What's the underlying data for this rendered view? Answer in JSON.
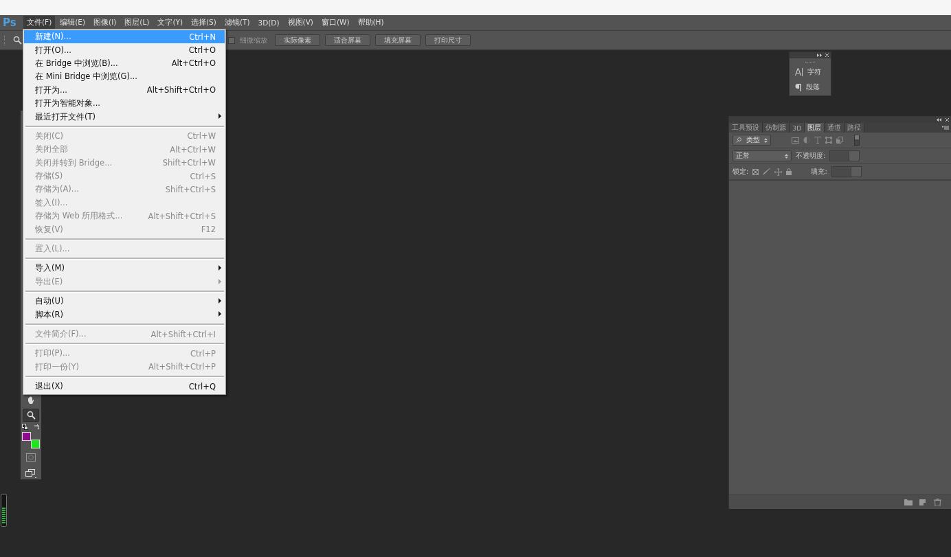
{
  "app": {
    "logo": "Ps"
  },
  "menubar": [
    {
      "label": "文件(F)",
      "selected": true
    },
    {
      "label": "编辑(E)",
      "selected": false
    },
    {
      "label": "图像(I)",
      "selected": false
    },
    {
      "label": "图层(L)",
      "selected": false
    },
    {
      "label": "文字(Y)",
      "selected": false
    },
    {
      "label": "选择(S)",
      "selected": false
    },
    {
      "label": "滤镜(T)",
      "selected": false
    },
    {
      "label": "3D(D)",
      "selected": false
    },
    {
      "label": "视图(V)",
      "selected": false
    },
    {
      "label": "窗口(W)",
      "selected": false
    },
    {
      "label": "帮助(H)",
      "selected": false
    }
  ],
  "options_bar": {
    "checkbox": {
      "label": "细微缩放",
      "checked": false
    },
    "buttons": [
      "实际像素",
      "适合屏幕",
      "填充屏幕",
      "打印尺寸"
    ]
  },
  "file_menu": [
    {
      "kind": "item",
      "label": "新建(N)...",
      "shortcut": "Ctrl+N",
      "disabled": false,
      "selected": true,
      "submenu": false
    },
    {
      "kind": "item",
      "label": "打开(O)...",
      "shortcut": "Ctrl+O",
      "disabled": false,
      "selected": false,
      "submenu": false
    },
    {
      "kind": "item",
      "label": "在 Bridge 中浏览(B)...",
      "shortcut": "Alt+Ctrl+O",
      "disabled": false,
      "selected": false,
      "submenu": false
    },
    {
      "kind": "item",
      "label": "在 Mini Bridge 中浏览(G)...",
      "disabled": false,
      "selected": false,
      "submenu": false
    },
    {
      "kind": "item",
      "label": "打开为...",
      "shortcut": "Alt+Shift+Ctrl+O",
      "disabled": false,
      "selected": false,
      "submenu": false
    },
    {
      "kind": "item",
      "label": "打开为智能对象...",
      "disabled": false,
      "selected": false,
      "submenu": false
    },
    {
      "kind": "item",
      "label": "最近打开文件(T)",
      "disabled": false,
      "selected": false,
      "submenu": true
    },
    {
      "kind": "separator"
    },
    {
      "kind": "item",
      "label": "关闭(C)",
      "shortcut": "Ctrl+W",
      "disabled": true,
      "selected": false,
      "submenu": false
    },
    {
      "kind": "item",
      "label": "关闭全部",
      "shortcut": "Alt+Ctrl+W",
      "disabled": true,
      "selected": false,
      "submenu": false
    },
    {
      "kind": "item",
      "label": "关闭并转到 Bridge...",
      "shortcut": "Shift+Ctrl+W",
      "disabled": true,
      "selected": false,
      "submenu": false
    },
    {
      "kind": "item",
      "label": "存储(S)",
      "shortcut": "Ctrl+S",
      "disabled": true,
      "selected": false,
      "submenu": false
    },
    {
      "kind": "item",
      "label": "存储为(A)...",
      "shortcut": "Shift+Ctrl+S",
      "disabled": true,
      "selected": false,
      "submenu": false
    },
    {
      "kind": "item",
      "label": "签入(I)...",
      "disabled": true,
      "selected": false,
      "submenu": false
    },
    {
      "kind": "item",
      "label": "存储为 Web 所用格式...",
      "shortcut": "Alt+Shift+Ctrl+S",
      "disabled": true,
      "selected": false,
      "submenu": false
    },
    {
      "kind": "item",
      "label": "恢复(V)",
      "shortcut": "F12",
      "disabled": true,
      "selected": false,
      "submenu": false
    },
    {
      "kind": "separator"
    },
    {
      "kind": "item",
      "label": "置入(L)...",
      "disabled": true,
      "selected": false,
      "submenu": false
    },
    {
      "kind": "separator"
    },
    {
      "kind": "item",
      "label": "导入(M)",
      "disabled": false,
      "selected": false,
      "submenu": true
    },
    {
      "kind": "item",
      "label": "导出(E)",
      "disabled": true,
      "selected": false,
      "submenu": true
    },
    {
      "kind": "separator"
    },
    {
      "kind": "item",
      "label": "自动(U)",
      "disabled": false,
      "selected": false,
      "submenu": true
    },
    {
      "kind": "item",
      "label": "脚本(R)",
      "disabled": false,
      "selected": false,
      "submenu": true
    },
    {
      "kind": "separator"
    },
    {
      "kind": "item",
      "label": "文件简介(F)...",
      "shortcut": "Alt+Shift+Ctrl+I",
      "disabled": true,
      "selected": false,
      "submenu": false
    },
    {
      "kind": "separator"
    },
    {
      "kind": "item",
      "label": "打印(P)...",
      "shortcut": "Ctrl+P",
      "disabled": true,
      "selected": false,
      "submenu": false
    },
    {
      "kind": "item",
      "label": "打印一份(Y)",
      "shortcut": "Alt+Shift+Ctrl+P",
      "disabled": true,
      "selected": false,
      "submenu": false
    },
    {
      "kind": "separator"
    },
    {
      "kind": "item",
      "label": "退出(X)",
      "shortcut": "Ctrl+Q",
      "disabled": false,
      "selected": false,
      "submenu": false
    }
  ],
  "toolbox": {
    "tools": [
      {
        "kind": "hand",
        "selected": false
      },
      {
        "kind": "zoom",
        "selected": true
      }
    ],
    "foreground": {
      "color": "#8c0a8c"
    },
    "background": {
      "color": "#1ee61e"
    }
  },
  "character_panel": {
    "items": [
      {
        "kind": "character",
        "label": "字符"
      },
      {
        "kind": "paragraph",
        "label": "段落"
      }
    ]
  },
  "layers_panel": {
    "tabs": [
      {
        "label": "工具预设",
        "selected": false
      },
      {
        "label": "仿制源",
        "selected": false
      },
      {
        "label": "3D",
        "selected": false
      },
      {
        "label": "图层",
        "selected": true
      },
      {
        "label": "通道",
        "selected": false
      },
      {
        "label": "路径",
        "selected": false
      }
    ],
    "filter": "类型",
    "blend_mode": "正常",
    "opacity_label": "不透明度:",
    "lock_label": "锁定:",
    "fill_label": "填充:"
  }
}
